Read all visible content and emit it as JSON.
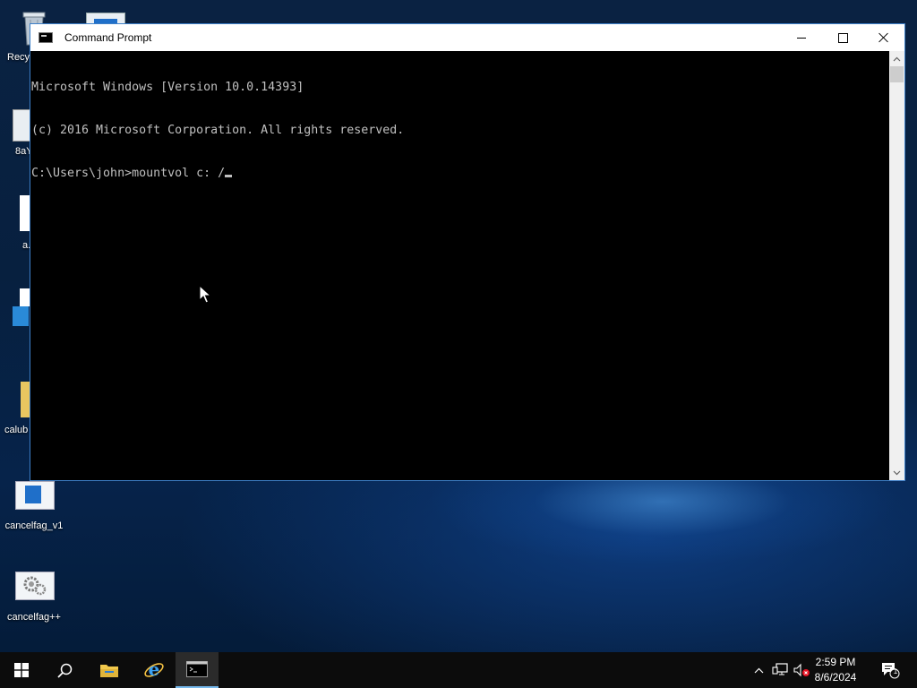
{
  "desktop": {
    "icons": [
      {
        "label": "Recy",
        "icon": "recycle-bin-icon"
      },
      {
        "label": "8aY",
        "icon": "image-file-icon"
      },
      {
        "label": "a.",
        "icon": "file-icon"
      },
      {
        "label": "",
        "icon": "app-package-icon"
      },
      {
        "label": "calub",
        "icon": "folder-icon"
      },
      {
        "label": "cancelfag_v1",
        "icon": "window-app-icon"
      },
      {
        "label": "cancelfag++",
        "icon": "gears-app-icon"
      }
    ]
  },
  "window": {
    "title": "Command Prompt",
    "console_lines": [
      "Microsoft Windows [Version 10.0.14393]",
      "(c) 2016 Microsoft Corporation. All rights reserved.",
      "C:\\Users\\john>mountvol c: /"
    ]
  },
  "taskbar": {
    "items": [
      "start-button",
      "search-button",
      "file-explorer",
      "internet-explorer",
      "command-prompt"
    ],
    "active_item": "command-prompt",
    "clock": {
      "time": "2:59 PM",
      "date": "8/6/2024"
    },
    "notifications_count": "1"
  },
  "colors": {
    "console_text": "#c0c0c0",
    "console_bg": "#000000",
    "window_border": "#3d7fc8",
    "taskbar_bg": "#0c0c0c",
    "accent": "#76b9ed"
  }
}
